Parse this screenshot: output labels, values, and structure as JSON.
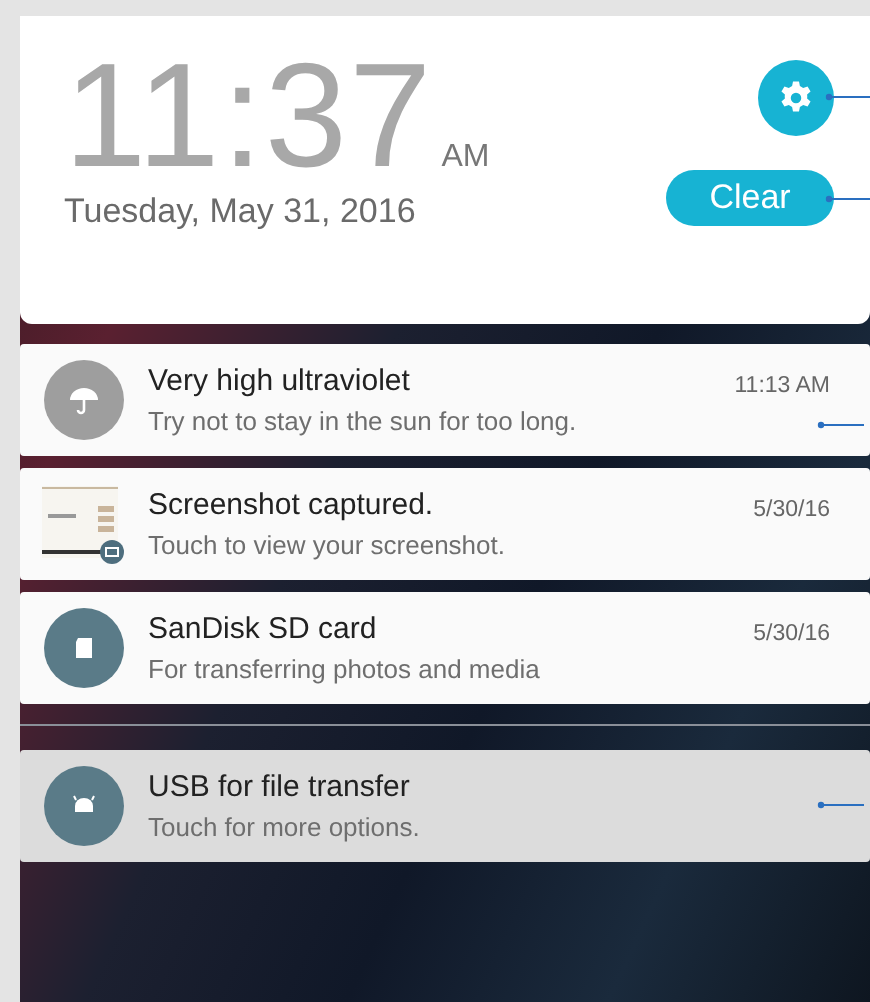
{
  "clock": {
    "time": "11:37",
    "meridiem": "AM",
    "date": "Tuesday, May 31, 2016",
    "clear_button": "Clear"
  },
  "notifications": [
    {
      "kind": "umbrella",
      "title": "Very high ultraviolet",
      "text": "Try not to stay in the sun for too long.",
      "time": "11:13 AM",
      "ongoing": false
    },
    {
      "kind": "screenshot",
      "title": "Screenshot captured.",
      "text": "Touch to view your screenshot.",
      "time": "5/30/16",
      "ongoing": false
    },
    {
      "kind": "sdcard",
      "title": "SanDisk SD card",
      "text": "For transferring photos and media",
      "time": "5/30/16",
      "ongoing": false
    },
    {
      "kind": "android",
      "title": "USB for file transfer",
      "text": "Touch for more options.",
      "ongoing": true
    }
  ]
}
